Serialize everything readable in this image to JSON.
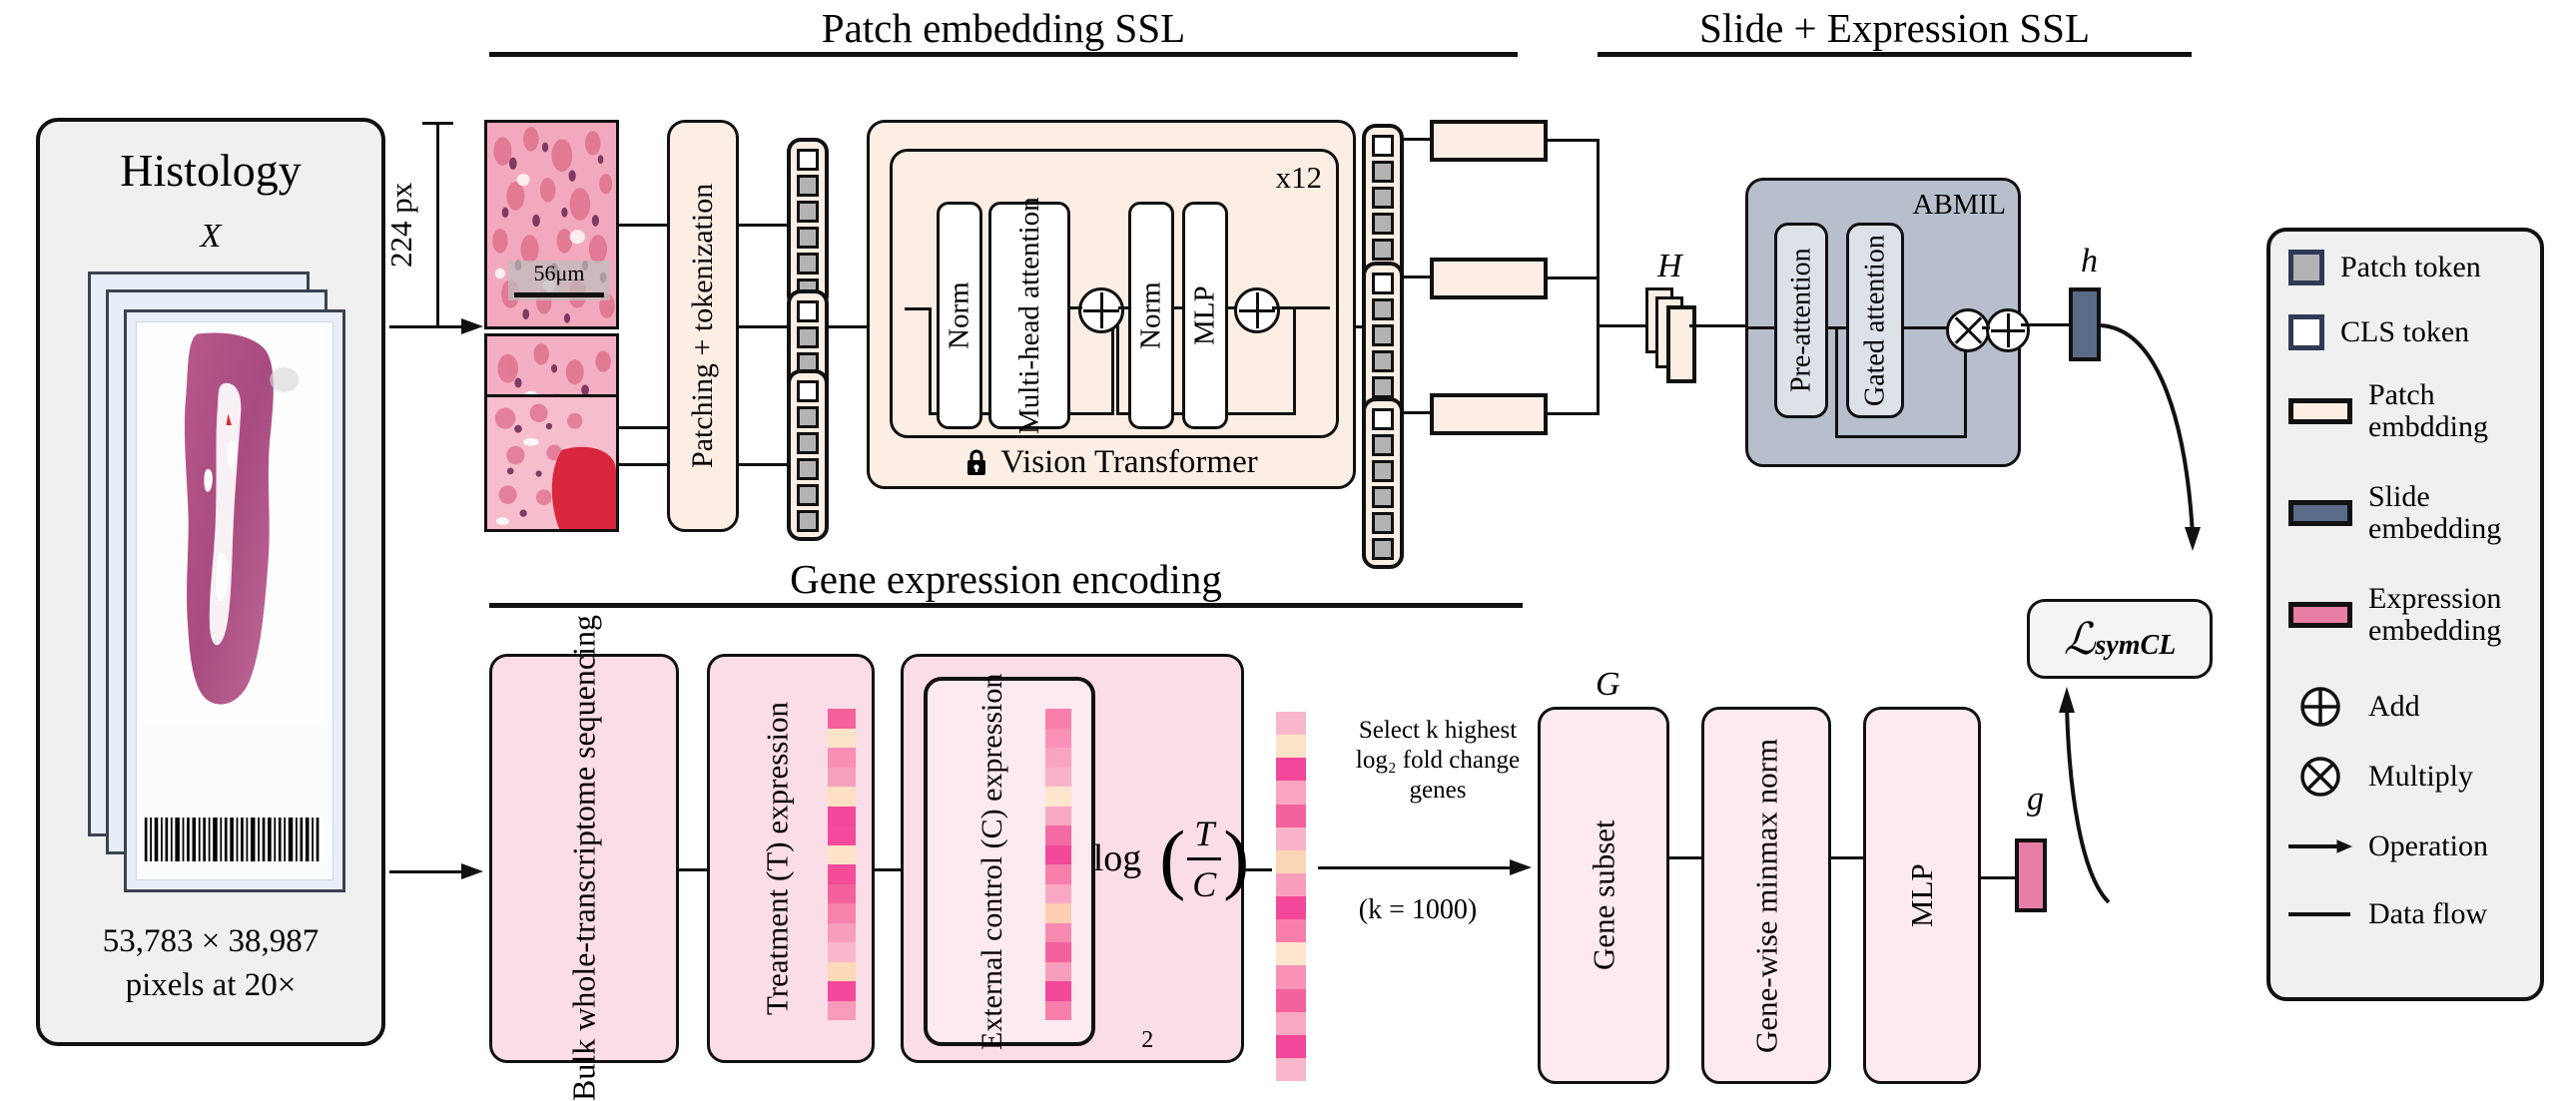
{
  "sections": {
    "patch_ssl": "Patch embedding SSL",
    "slide_expr_ssl": "Slide + Expression SSL",
    "gene_encoding": "Gene expression encoding"
  },
  "histology": {
    "title": "Histology",
    "symbol": "X",
    "dimensions_line1": "53,783 × 38,987",
    "dimensions_line2": "pixels at 20×"
  },
  "patches": {
    "size_label": "224 px",
    "scalebar_label": "56μm"
  },
  "patch_pipeline": {
    "patching": "Patching + tokenization",
    "vit_title": "Vision Transformer",
    "vit_lock_icon": "lock-icon",
    "repeat": "x12",
    "norm1": "Norm",
    "mhsa": "Multi-head attention",
    "norm2": "Norm",
    "mlp": "MLP"
  },
  "slide_branch": {
    "H": "H",
    "abmil": "ABMIL",
    "pre_attention": "Pre-attention",
    "gated_attention": "Gated attention",
    "h": "h"
  },
  "loss": {
    "symbol": "ℒ",
    "subscript": "symCL"
  },
  "gene_branch": {
    "bulk_seq": "Bulk whole-transcriptome sequencing",
    "treatment": "Treatment (T) expression",
    "external_control": "External control (C) expression",
    "log_fc_num": "T",
    "log_fc_den": "C",
    "log_fc_prefix": "log",
    "log_fc_base": "2",
    "select_note_line1": "Select k highest",
    "select_note_line2": "log₂ fold change",
    "select_note_line3": "genes",
    "k_value": "(k = 1000)",
    "G": "G",
    "gene_subset": "Gene subset",
    "minmax": "Gene-wise minmax norm",
    "mlp": "MLP",
    "g": "g"
  },
  "legend": {
    "items": [
      {
        "label": "Patch token",
        "icon": "square-filled-grey",
        "color": "#b3b3b3",
        "border": "#2f3b56"
      },
      {
        "label": "CLS token",
        "icon": "square-outline-white",
        "color": "#ffffff",
        "border": "#2f3b56"
      },
      {
        "label": "Patch embdding",
        "icon": "rect-cream",
        "color": "#fdeee4",
        "border": "#111111"
      },
      {
        "label": "Slide embedding",
        "icon": "rect-slate",
        "color": "#5a6b87",
        "border": "#111111"
      },
      {
        "label": "Expression embedding",
        "icon": "rect-pink",
        "color": "#e87ea5",
        "border": "#111111"
      },
      {
        "label": "Add",
        "icon": "circle-plus-icon"
      },
      {
        "label": "Multiply",
        "icon": "circle-times-icon"
      },
      {
        "label": "Operation",
        "icon": "arrow-right-icon"
      },
      {
        "label": "Data flow",
        "icon": "line-icon"
      }
    ]
  },
  "colors": {
    "patch_embedding": "#fdeee4",
    "slide_embedding": "#5a6b87",
    "expression_embedding": "#e87ea5",
    "abmil_fill": "#b7bfcc",
    "gene_box": "#fbdde7",
    "card_bg": "#f0f0f0"
  },
  "expression_strips": {
    "treatment": [
      "#f3629c",
      "#fbe3c8",
      "#f88fb4",
      "#f5a0bf",
      "#fde0c4",
      "#f3479a",
      "#f34b9b",
      "#fde3c8",
      "#f24c9a",
      "#f3629c",
      "#f783ad",
      "#f79ebc",
      "#f9b7cb",
      "#fcd9b8",
      "#f3479a",
      "#f79bbb"
    ],
    "control": [
      "#f87fac",
      "#f992b6",
      "#f9a5c1",
      "#f9b3c8",
      "#fde6cd",
      "#f9a8c3",
      "#f46ba3",
      "#f3479a",
      "#f87fac",
      "#f9a8c3",
      "#fbcfb2",
      "#f789b1",
      "#f3629c",
      "#f79ebc",
      "#f3479a",
      "#f87fac"
    ],
    "logfc": [
      "#f9b7cb",
      "#fbe3c8",
      "#f3479a",
      "#f9a5c1",
      "#f3629c",
      "#f9b3c8",
      "#fbd6b5",
      "#f79ebc",
      "#f3479a",
      "#f87fac",
      "#fde6cd",
      "#f992b6",
      "#f3629c",
      "#f9a8c3",
      "#f3479a",
      "#f9b7cb"
    ]
  }
}
